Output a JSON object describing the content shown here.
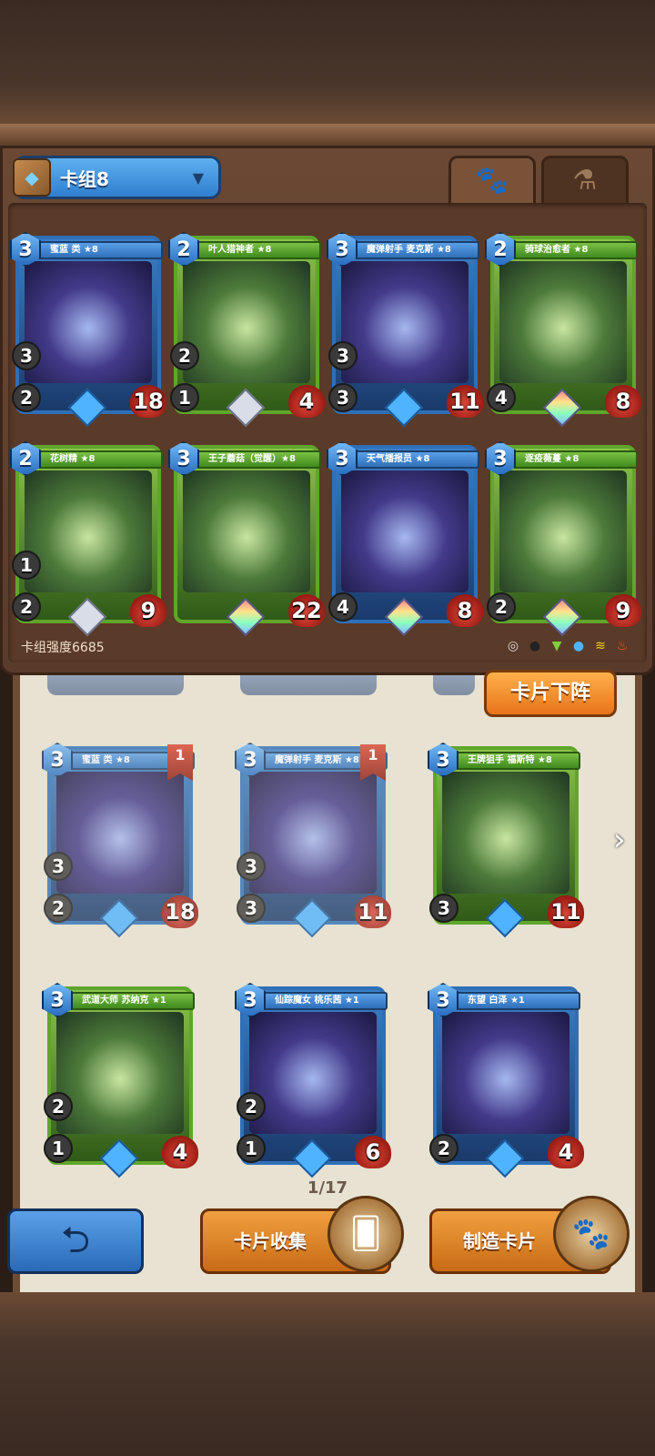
{
  "deck": {
    "name": "卡组8",
    "strength_label": "卡组强度6685",
    "tabs": [
      "paw-icon",
      "potion-icon"
    ],
    "cards": [
      {
        "name": "蜜蓝 类 ★8",
        "cost": "3",
        "stat1": "3",
        "stat2": "2",
        "hp": "18",
        "frame": "blue",
        "gem": "star"
      },
      {
        "name": "叶人猎神者 ★8",
        "cost": "2",
        "stat1": "2",
        "stat2": "1",
        "hp": "4",
        "frame": "green",
        "gem": "plain"
      },
      {
        "name": "魔弹射手 麦克斯 ★8",
        "cost": "3",
        "stat1": "3",
        "stat2": "3",
        "hp": "11",
        "frame": "blue",
        "gem": "star"
      },
      {
        "name": "骑球治愈者 ★8",
        "cost": "2",
        "stat1": "",
        "stat2": "4",
        "hp": "8",
        "frame": "green",
        "gem": "rainbow"
      },
      {
        "name": "花树精 ★8",
        "cost": "2",
        "stat1": "1",
        "stat2": "2",
        "hp": "9",
        "frame": "green",
        "gem": "plain"
      },
      {
        "name": "王子蘑菇（觉醒）★8",
        "cost": "3",
        "stat1": "",
        "stat2": "",
        "hp": "22",
        "frame": "green",
        "gem": "rainbow"
      },
      {
        "name": "天气播报员 ★8",
        "cost": "3",
        "stat1": "",
        "stat2": "4",
        "hp": "8",
        "frame": "blue",
        "gem": "rainbow"
      },
      {
        "name": "逐疫薇蔓 ★8",
        "cost": "3",
        "stat1": "",
        "stat2": "2",
        "hp": "9",
        "frame": "green",
        "gem": "rainbow"
      }
    ]
  },
  "unload_button": "卡片下阵",
  "collection": {
    "cards": [
      {
        "name": "蜜蓝 类 ★8",
        "cost": "3",
        "stat1": "3",
        "stat2": "2",
        "hp": "18",
        "flag": "1",
        "frame": "blue"
      },
      {
        "name": "魔弹射手 麦克斯 ★8",
        "cost": "3",
        "stat1": "3",
        "stat2": "3",
        "hp": "11",
        "flag": "1",
        "frame": "blue"
      },
      {
        "name": "王牌狙手 福斯特 ★8",
        "cost": "3",
        "stat1": "",
        "stat2": "3",
        "hp": "11",
        "flag": "",
        "frame": "green"
      },
      {
        "name": "武道大师 苏纳克 ★1",
        "cost": "3",
        "stat1": "2",
        "stat2": "1",
        "hp": "4",
        "flag": "",
        "frame": "green"
      },
      {
        "name": "仙踪魔女 桃乐茜 ★1",
        "cost": "3",
        "stat1": "2",
        "stat2": "1",
        "hp": "6",
        "flag": "",
        "frame": "blue"
      },
      {
        "name": "东望 白泽 ★1",
        "cost": "3",
        "stat1": "",
        "stat2": "2",
        "hp": "4",
        "flag": "",
        "frame": "blue"
      }
    ],
    "page_indicator": "1/17"
  },
  "bottom": {
    "back_icon": "back-arrow-icon",
    "collect_label": "卡片收集",
    "craft_label": "制造卡片"
  }
}
